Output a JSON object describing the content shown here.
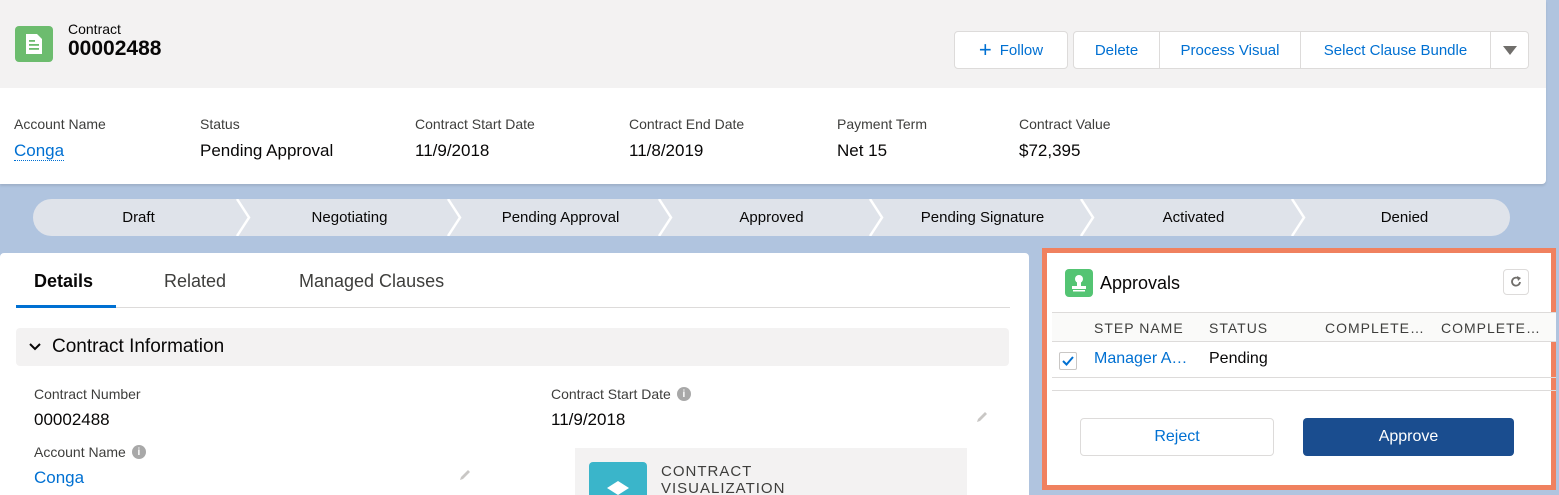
{
  "header": {
    "object_label": "Contract",
    "record_name": "00002488",
    "follow_label": "Follow",
    "actions": [
      "Delete",
      "Process Visual",
      "Select Clause Bundle"
    ]
  },
  "highlights": [
    {
      "label": "Account Name",
      "value": "Conga",
      "link": true
    },
    {
      "label": "Status",
      "value": "Pending Approval",
      "link": false
    },
    {
      "label": "Contract Start Date",
      "value": "11/9/2018",
      "link": false
    },
    {
      "label": "Contract End Date",
      "value": "11/8/2019",
      "link": false
    },
    {
      "label": "Payment Term",
      "value": "Net 15",
      "link": false
    },
    {
      "label": "Contract Value",
      "value": "$72,395",
      "link": false
    }
  ],
  "path": [
    "Draft",
    "Negotiating",
    "Pending Approval",
    "Approved",
    "Pending Signature",
    "Activated",
    "Denied"
  ],
  "tabs": [
    "Details",
    "Related",
    "Managed Clauses"
  ],
  "section": {
    "title": "Contract Information",
    "fields": {
      "contract_number": {
        "label": "Contract Number",
        "value": "00002488"
      },
      "contract_start_date": {
        "label": "Contract Start Date",
        "value": "11/9/2018"
      },
      "account_name": {
        "label": "Account Name",
        "value": "Conga"
      }
    },
    "visualization": {
      "line1": "CONTRACT",
      "line2": "VISUALIZATION"
    }
  },
  "approvals": {
    "title": "Approvals",
    "columns": [
      "STEP NAME",
      "STATUS",
      "COMPLETE…",
      "COMPLETE…"
    ],
    "rows": [
      {
        "step_name": "Manager A…",
        "status": "Pending",
        "checked": true
      }
    ],
    "reject_label": "Reject",
    "approve_label": "Approve"
  },
  "colors": {
    "accent": "#0070d2",
    "record_icon": "#6cbc6e",
    "approve_button": "#1a4d8f",
    "highlight_border": "#f0815f"
  }
}
